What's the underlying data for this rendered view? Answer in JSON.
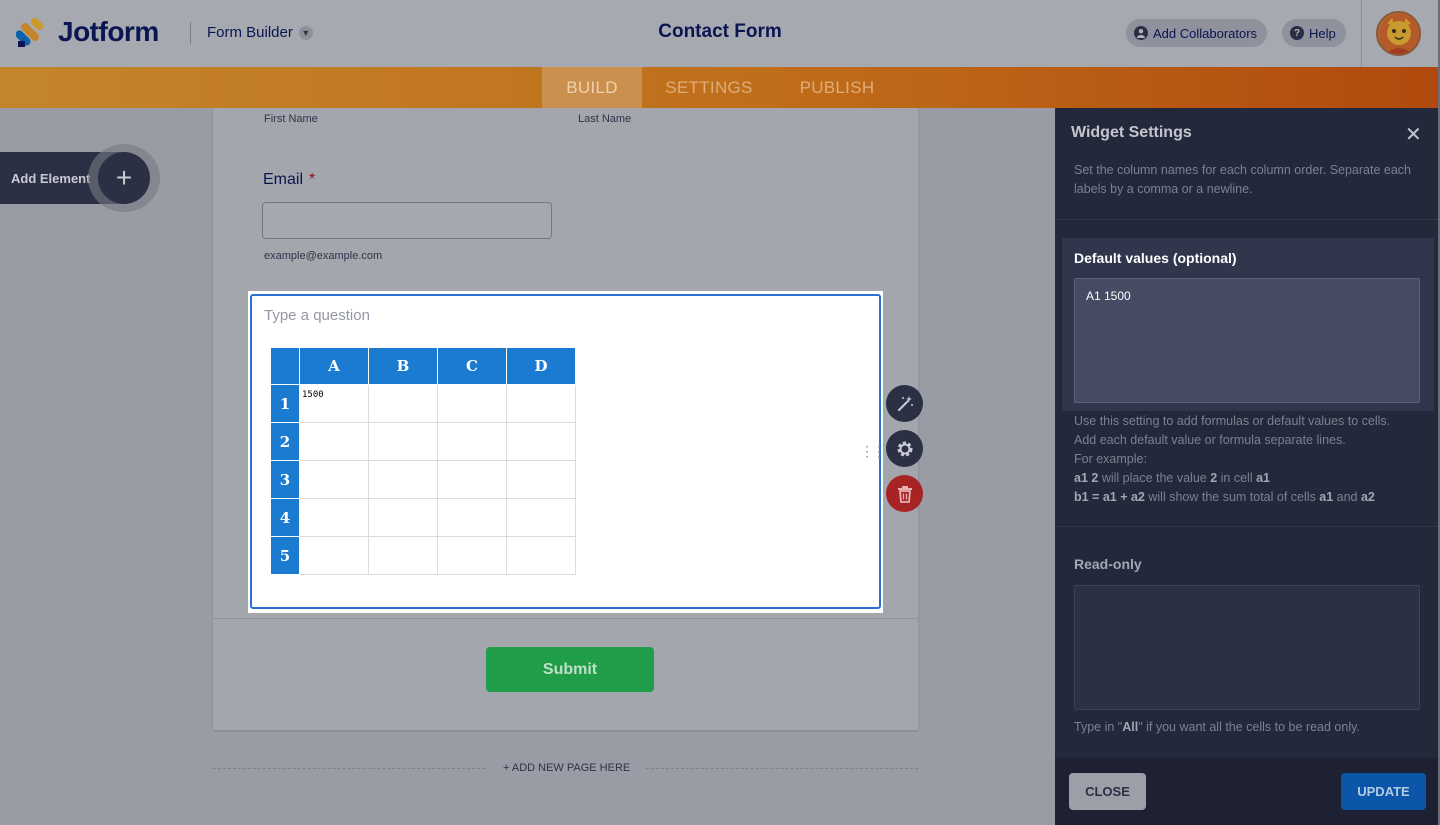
{
  "header": {
    "brand": "Jotform",
    "builder_label": "Form Builder",
    "form_title": "Contact Form",
    "add_collaborators": "Add Collaborators",
    "help": "Help"
  },
  "tabs": [
    {
      "label": "BUILD",
      "active": true
    },
    {
      "label": "SETTINGS",
      "active": false
    },
    {
      "label": "PUBLISH",
      "active": false
    }
  ],
  "form": {
    "first_name_sublabel": "First Name",
    "last_name_sublabel": "Last Name",
    "email_label": "Email",
    "required_mark": "*",
    "email_value": "",
    "email_sublabel": "example@example.com",
    "widget_question_placeholder": "Type a question",
    "spreadsheet": {
      "columns": [
        "A",
        "B",
        "C",
        "D"
      ],
      "rows": [
        "1",
        "2",
        "3",
        "4",
        "5"
      ],
      "cells": [
        [
          "1500",
          "",
          "",
          ""
        ],
        [
          "",
          "",
          "",
          ""
        ],
        [
          "",
          "",
          "",
          ""
        ],
        [
          "",
          "",
          "",
          ""
        ],
        [
          "",
          "",
          "",
          ""
        ]
      ]
    },
    "submit_label": "Submit",
    "add_new_page": "+ ADD NEW PAGE HERE"
  },
  "add_element": {
    "label": "Add Element",
    "plus": "+"
  },
  "widget_settings": {
    "title": "Widget Settings",
    "close_glyph": "✕",
    "column_names_desc": "Set the column names for each column order. Separate each labels by a comma or a newline.",
    "default_values": {
      "label": "Default values (optional)",
      "value": "A1 1500",
      "help_line1": "Use this setting to add formulas or default values to cells.",
      "help_line2": "Add each default value or formula separate lines.",
      "help_line3": "For example:",
      "ex1_code": "a1 2",
      "ex1_mid": " will place the value ",
      "ex1_val": "2",
      "ex1_tail": " in cell ",
      "ex1_cell": "a1",
      "ex2_code": "b1 = a1 + a2",
      "ex2_mid": " will show the sum total of cells ",
      "ex2_a": "a1",
      "ex2_and": " and ",
      "ex2_b": "a2"
    },
    "read_only": {
      "label": "Read-only",
      "value": "",
      "help_pre": "Type in \"",
      "help_all": "All",
      "help_post": "\" if you want all the cells to be read only."
    },
    "close_button": "CLOSE",
    "update_button": "UPDATE"
  },
  "colors": {
    "brand_orange": "#ff6100",
    "sheet_blue": "#1a7bd0",
    "submit_green": "#1f9d48",
    "update_blue": "#0b56a8",
    "delete_red": "#d62b2b"
  },
  "icons": [
    "jotform-logo-icon",
    "chevron-down-icon",
    "user-icon",
    "help-icon",
    "avatar-cat-icon",
    "plus-icon",
    "wand-icon",
    "gear-icon",
    "trash-icon",
    "drag-handle-icon",
    "close-icon"
  ]
}
